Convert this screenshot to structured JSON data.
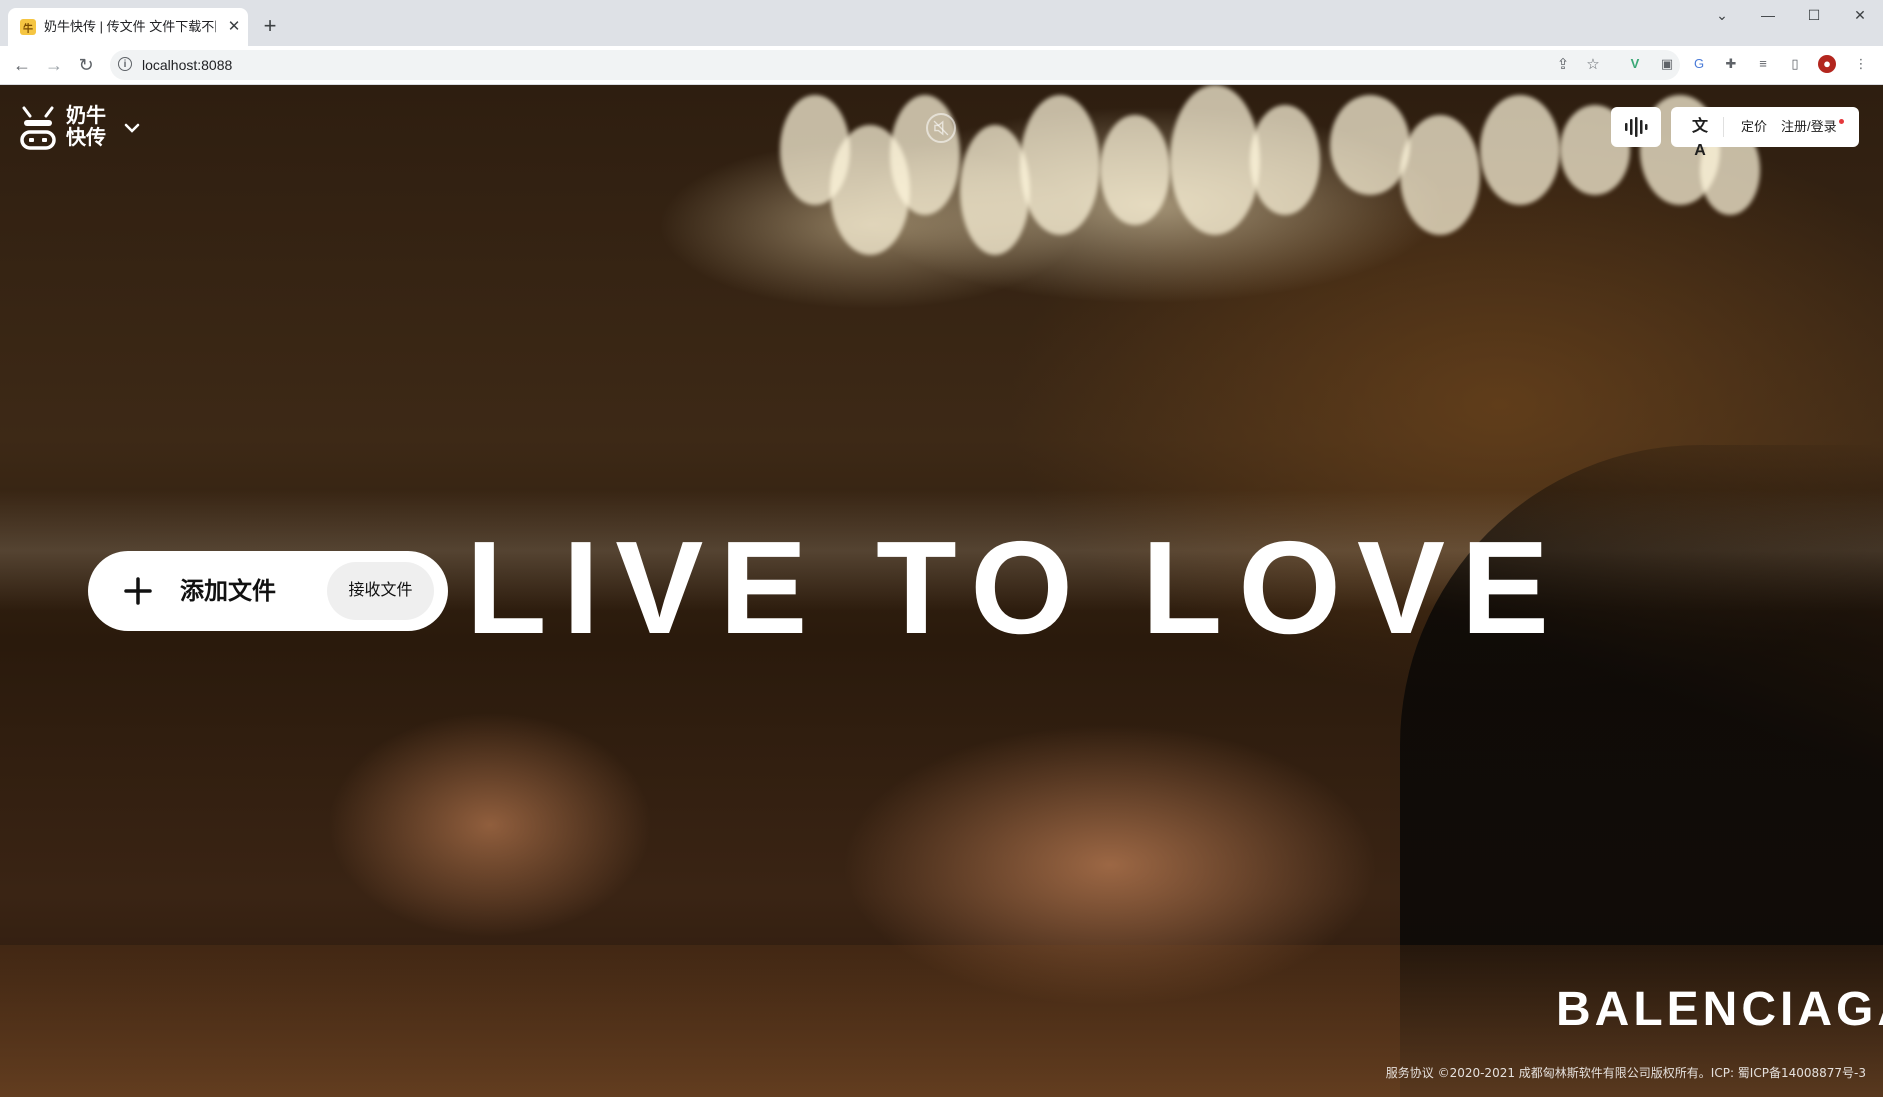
{
  "browser": {
    "tab_title": "奶牛快传 | 传文件 文件下载不限速",
    "tab_close": "✕",
    "new_tab": "+",
    "url": "localhost:8088"
  },
  "header": {
    "logo_line1": "奶牛",
    "logo_line2": "快传",
    "pricing": "定价",
    "login": "注册/登录"
  },
  "cta": {
    "add_label": "添加文件",
    "receive_label": "接收文件"
  },
  "hero": {
    "title": "LIVE TO LOVE",
    "brand": "BALENCIAGA"
  },
  "footer": {
    "text": "服务协议 ©2020-2021 成都匈林斯软件有限公司版权所有。ICP: 蜀ICP备14008877号-3"
  },
  "icons": {
    "favicon": "cow-favicon-icon",
    "back": "arrow-left-icon",
    "forward": "arrow-right-icon",
    "reload": "reload-icon",
    "info": "info-icon",
    "share": "share-icon",
    "bookmark": "star-icon",
    "extensions": "puzzle-icon",
    "mute": "speaker-muted-icon",
    "waveform": "waveform-icon",
    "translate": "translate-icon"
  },
  "colors": {
    "tabstrip": "#dee1e6",
    "white": "#ffffff",
    "notification_dot": "#e5383b"
  }
}
